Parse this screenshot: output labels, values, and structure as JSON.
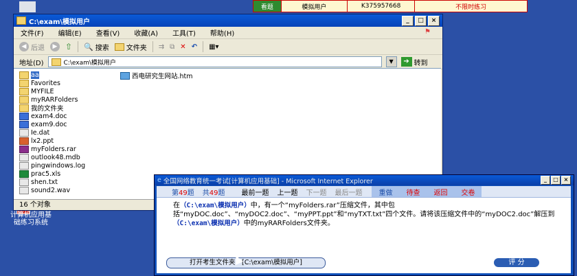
{
  "status_bar": {
    "tab": "看题",
    "user": "模拟用户",
    "id": "K375957668",
    "mode": "不限时练习"
  },
  "desktop": {
    "label_line1": "计算机应用基",
    "label_line2": "础练习系统"
  },
  "explorer": {
    "title": "C:\\exam\\模拟用户",
    "menu": [
      "文件(F)",
      "编辑(E)",
      "查看(V)",
      "收藏(A)",
      "工具(T)",
      "帮助(H)"
    ],
    "toolbar": {
      "back": "后退",
      "search": "搜索",
      "folders": "文件夹"
    },
    "address": {
      "label": "地址(D)",
      "value": "C:\\exam\\模拟用户",
      "go": "转到"
    },
    "files": [
      {
        "name": "aa",
        "type": "folder"
      },
      {
        "name": "Favorites",
        "type": "folder"
      },
      {
        "name": "MYFILE",
        "type": "folder"
      },
      {
        "name": "myRARFolders",
        "type": "folder"
      },
      {
        "name": "我的文件夹",
        "type": "folder"
      },
      {
        "name": "exam4.doc",
        "type": "doc"
      },
      {
        "name": "exam9.doc",
        "type": "doc"
      },
      {
        "name": "Ie.dat",
        "type": "file"
      },
      {
        "name": "lx2.ppt",
        "type": "ppt"
      },
      {
        "name": "myFolders.rar",
        "type": "rar"
      },
      {
        "name": "outlook48.mdb",
        "type": "file"
      },
      {
        "name": "pingwindows.log",
        "type": "file"
      },
      {
        "name": "prac5.xls",
        "type": "xls"
      },
      {
        "name": "shen.txt",
        "type": "file"
      },
      {
        "name": "sound2.wav",
        "type": "file"
      }
    ],
    "html_file": "西电研究生网站.htm",
    "status": "16 个对象"
  },
  "ie": {
    "title": "全国网络教育统一考试[计算机应用基础] - Microsoft Internet Explorer",
    "nav": {
      "current_prefix": "第",
      "current": "49",
      "current_suffix": "题",
      "total_prefix": "共",
      "total": "49",
      "total_suffix": "题",
      "first": "最前一题",
      "prev": "上一题",
      "next": "下一题",
      "last": "最后一题",
      "redo": "重做",
      "pending": "待查",
      "back": "返回",
      "submit": "交卷"
    },
    "question": {
      "part1": "在",
      "path1": "（C:\\exam\\模拟用户）",
      "part2": "中，有一个“myFolders.rar”压缩文件，其中包括“myDOC.doc”、“myDOC2.doc”、“myPPT.ppt”和“myTXT.txt”四个文件。请将该压缩文件中的“myDOC2.doc”解压到",
      "path2": "（C:\\exam\\模拟用户）",
      "part3": "中的myRARFolders文件夹。"
    },
    "open_button": "打开考生文件夹：[C:\\exam\\模拟用户]",
    "score_button": "评 分"
  }
}
